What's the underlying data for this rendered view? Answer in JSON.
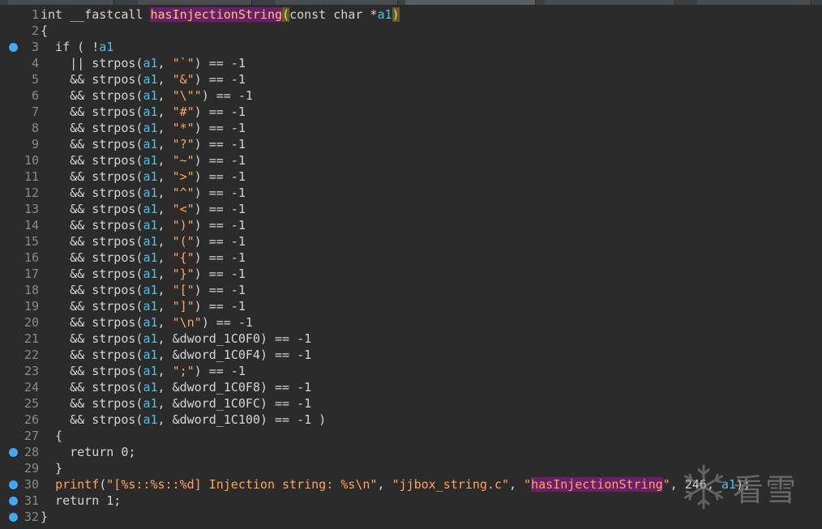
{
  "editor": {
    "lines": [
      {
        "n": "1",
        "bp": false,
        "src": "int __fastcall hasInjectionString(const char *a1)"
      },
      {
        "n": "2",
        "bp": false,
        "src": "{"
      },
      {
        "n": "3",
        "bp": true,
        "src": "  if ( !a1"
      },
      {
        "n": "4",
        "bp": false,
        "src": "    || strpos(a1, \"`\") == -1"
      },
      {
        "n": "5",
        "bp": false,
        "src": "    && strpos(a1, \"&\") == -1"
      },
      {
        "n": "6",
        "bp": false,
        "src": "    && strpos(a1, \"\\\"\") == -1"
      },
      {
        "n": "7",
        "bp": false,
        "src": "    && strpos(a1, \"#\") == -1"
      },
      {
        "n": "8",
        "bp": false,
        "src": "    && strpos(a1, \"*\") == -1"
      },
      {
        "n": "9",
        "bp": false,
        "src": "    && strpos(a1, \"?\") == -1"
      },
      {
        "n": "10",
        "bp": false,
        "src": "    && strpos(a1, \"~\") == -1"
      },
      {
        "n": "11",
        "bp": false,
        "src": "    && strpos(a1, \">\") == -1"
      },
      {
        "n": "12",
        "bp": false,
        "src": "    && strpos(a1, \"^\") == -1"
      },
      {
        "n": "13",
        "bp": false,
        "src": "    && strpos(a1, \"<\") == -1"
      },
      {
        "n": "14",
        "bp": false,
        "src": "    && strpos(a1, \")\") == -1"
      },
      {
        "n": "15",
        "bp": false,
        "src": "    && strpos(a1, \"(\") == -1"
      },
      {
        "n": "16",
        "bp": false,
        "src": "    && strpos(a1, \"{\") == -1"
      },
      {
        "n": "17",
        "bp": false,
        "src": "    && strpos(a1, \"}\") == -1"
      },
      {
        "n": "18",
        "bp": false,
        "src": "    && strpos(a1, \"[\") == -1"
      },
      {
        "n": "19",
        "bp": false,
        "src": "    && strpos(a1, \"]\") == -1"
      },
      {
        "n": "20",
        "bp": false,
        "src": "    && strpos(a1, \"\\n\") == -1"
      },
      {
        "n": "21",
        "bp": false,
        "src": "    && strpos(a1, &dword_1C0F0) == -1"
      },
      {
        "n": "22",
        "bp": false,
        "src": "    && strpos(a1, &dword_1C0F4) == -1"
      },
      {
        "n": "23",
        "bp": false,
        "src": "    && strpos(a1, \";\") == -1"
      },
      {
        "n": "24",
        "bp": false,
        "src": "    && strpos(a1, &dword_1C0F8) == -1"
      },
      {
        "n": "25",
        "bp": false,
        "src": "    && strpos(a1, &dword_1C0FC) == -1"
      },
      {
        "n": "26",
        "bp": false,
        "src": "    && strpos(a1, &dword_1C100) == -1 )"
      },
      {
        "n": "27",
        "bp": false,
        "src": "  {"
      },
      {
        "n": "28",
        "bp": true,
        "src": "    return 0;"
      },
      {
        "n": "29",
        "bp": false,
        "src": "  }"
      },
      {
        "n": "30",
        "bp": true,
        "src": "  printf(\"[%s::%s::%d] Injection string: %s\\n\", \"jjbox_string.c\", \"hasInjectionString\", 246, a1);"
      },
      {
        "n": "31",
        "bp": true,
        "src": "  return 1;"
      },
      {
        "n": "32",
        "bp": true,
        "src": "}"
      }
    ]
  },
  "watermark": {
    "text": "看雪",
    "icon": "snowflake-icon"
  },
  "colors": {
    "background": "#2b2b2b",
    "line_number": "#8a8a8a",
    "string": "#ffa657",
    "variable": "#4fc1e9",
    "function_highlight": "#6a1f6a",
    "breakpoint": "#3fa9f5"
  }
}
